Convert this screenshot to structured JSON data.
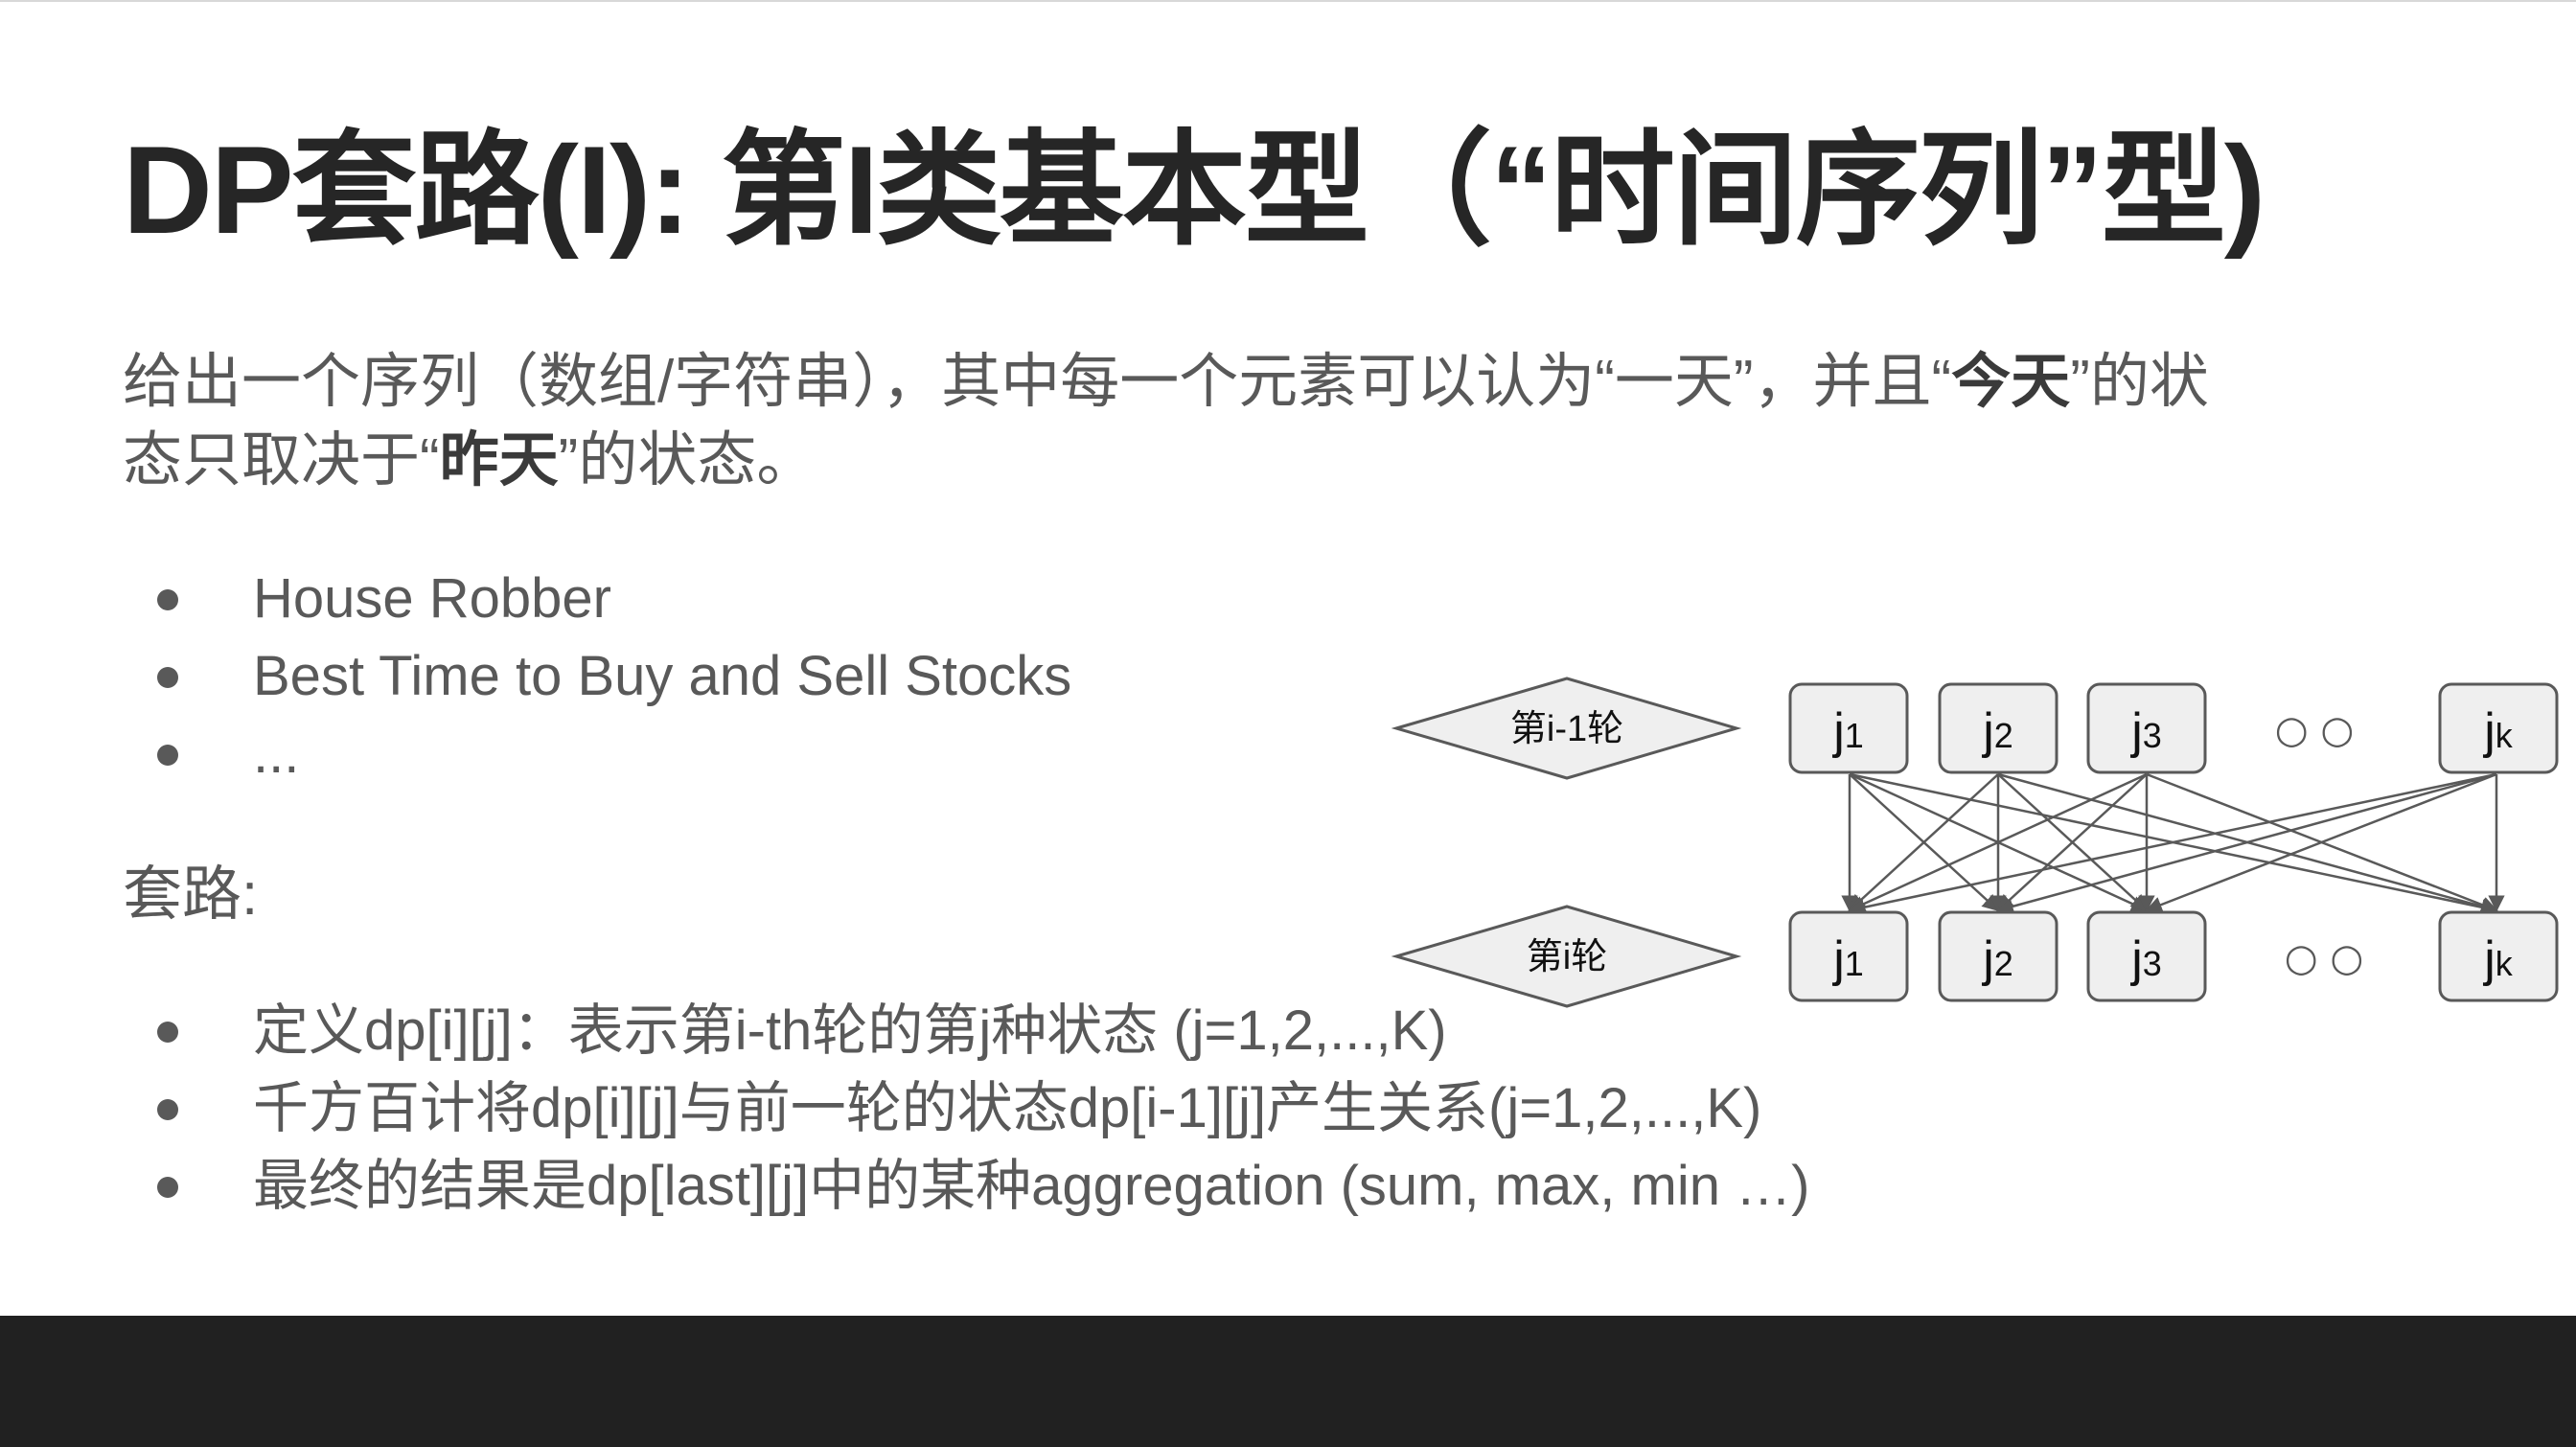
{
  "slide": {
    "title": "DP套路(I): 第I类基本型（“时间序列”型)",
    "intro": {
      "part1": "给出一个序列（数组/字符串），其中每一个元素可以认为“一天”，并且“",
      "bold1": "今天",
      "part2": "”的状态只取决于“",
      "bold2": "昨天",
      "part3": "”的状态。"
    },
    "examples": [
      "House Robber",
      "Best Time to Buy and Sell Stocks",
      "..."
    ],
    "routine_label": "套路:",
    "steps": [
      "定义dp[i][j]：表示第i-th轮的第j种状态 (j=1,2,...,K)",
      "千方百计将dp[i][j]与前一轮的状态dp[i-1][j]产生关系(j=1,2,...,K)",
      "最终的结果是dp[last][j]中的某种aggregation (sum, max, min …)"
    ]
  },
  "diagram": {
    "prev_round_label": "第i-1轮",
    "curr_round_label": "第i轮",
    "node_base": "j",
    "node_subscripts": [
      "1",
      "2",
      "3",
      "k"
    ],
    "ellipsis": "○ ○",
    "colors": {
      "node_fill": "#efefef",
      "node_stroke": "#595959",
      "arrow": "#595959"
    }
  },
  "colors": {
    "title": "#262626",
    "body_text": "#595959",
    "footer": "#212121"
  }
}
